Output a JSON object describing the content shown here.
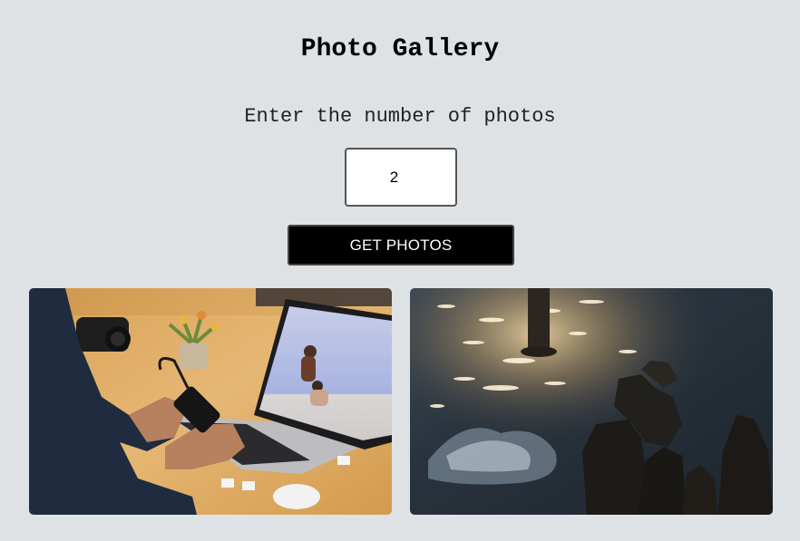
{
  "header": {
    "title": "Photo Gallery"
  },
  "form": {
    "prompt": "Enter the number of photos",
    "count_value": "2",
    "button_label": "GET PHOTOS"
  },
  "gallery": {
    "photos": [
      {
        "subject": "person-using-laptop-and-phone-at-desk"
      },
      {
        "subject": "sunlit-water-splashing-on-dark-rocks"
      }
    ]
  },
  "colors": {
    "background": "#dfe2e5",
    "button_bg": "#000000",
    "button_text": "#ffffff"
  }
}
